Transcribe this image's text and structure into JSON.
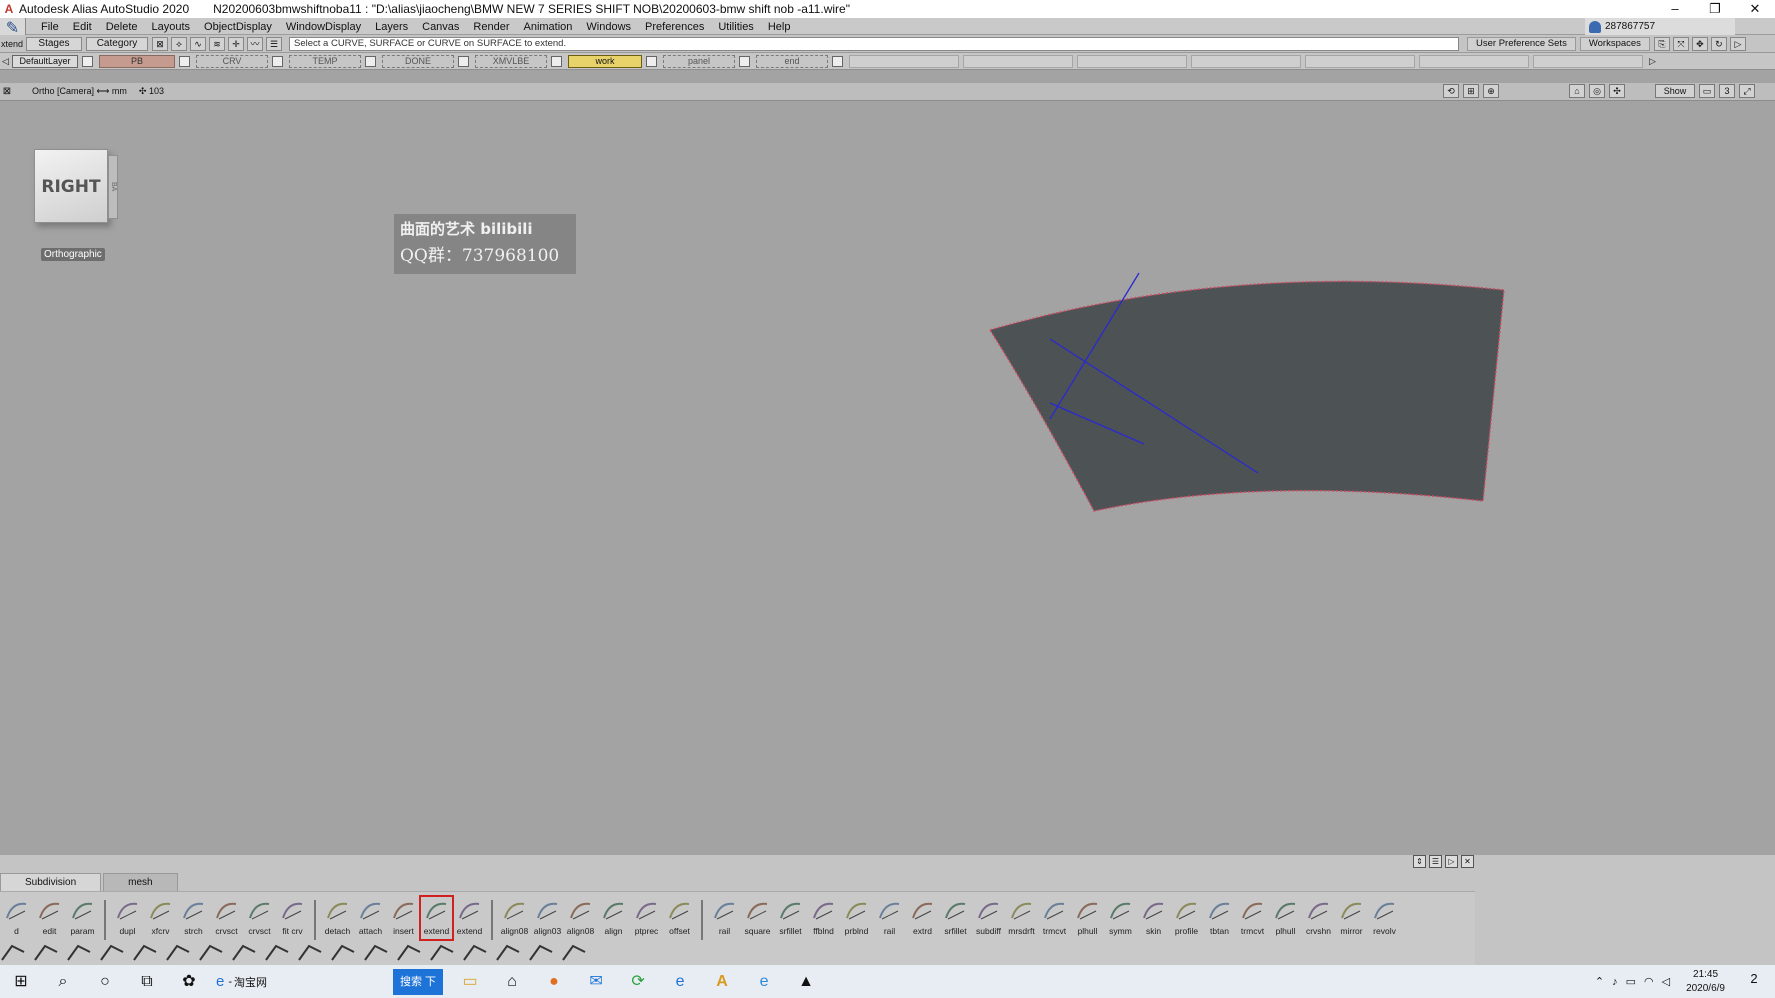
{
  "titlebar": {
    "app_name": "Autodesk Alias AutoStudio 2020",
    "doc_title": "N20200603bmwshiftnoba11 : \"D:\\alias\\jiaocheng\\BMW NEW 7 SERIES SHIFT NOB\\20200603-bmw shift nob -a11.wire\"",
    "minimize": "–",
    "restore": "❐",
    "close": "✕"
  },
  "menubar": {
    "items": [
      "File",
      "Edit",
      "Delete",
      "Layouts",
      "ObjectDisplay",
      "WindowDisplay",
      "Layers",
      "Canvas",
      "Render",
      "Animation",
      "Windows",
      "Preferences",
      "Utilities",
      "Help"
    ],
    "user_id": "287867757"
  },
  "promptbar": {
    "mode": "xtend",
    "stages": "Stages",
    "category": "Category",
    "prompt": "Select a CURVE, SURFACE or CURVE on SURFACE to extend.",
    "user_pref_sets": "User Preference Sets",
    "workspaces": "Workspaces"
  },
  "layerbar": {
    "default_layer": "DefaultLayer",
    "layers": [
      {
        "label": "PB",
        "style": "pb"
      },
      {
        "label": "CRV",
        "style": "dashed"
      },
      {
        "label": "TEMP",
        "style": "dashed"
      },
      {
        "label": "DONE",
        "style": "dashed"
      },
      {
        "label": "XMVLBE",
        "style": "dashed"
      },
      {
        "label": "work",
        "style": "active"
      },
      {
        "label": "panel",
        "style": "dashed"
      },
      {
        "label": "end",
        "style": "dashed"
      }
    ]
  },
  "viewheader": {
    "view_label": "Ortho [Camera]  ⟷ mm",
    "zoom_label": "✣ 103",
    "show_label": "Show"
  },
  "viewport": {
    "cube_face": "RIGHT",
    "cube_side": "BA",
    "ortho_label": "Orthographic",
    "watermark_line1": "曲面的艺术 bilibili",
    "watermark_line2": "QQ群：737968100",
    "surface_color": "#4d5255",
    "edge_color": "#d04860",
    "curve_color": "#2a2ad0"
  },
  "palette": {
    "tabs": [
      "Subdivision",
      "mesh"
    ],
    "tools": [
      "d",
      "edit",
      "param",
      "dupl",
      "xfcrv",
      "strch",
      "crvsct",
      "crvsct",
      "fit crv",
      "detach",
      "attach",
      "insert",
      "extend",
      "extend",
      "align08",
      "align03",
      "align08",
      "align",
      "ptprec",
      "offset",
      "rail",
      "square",
      "srfillet",
      "ffblnd",
      "prblnd",
      "rail",
      "extrd",
      "srfillet",
      "subdiff",
      "mrsdrft",
      "trmcvt",
      "plhull",
      "symm",
      "skin",
      "profile",
      "tbtan",
      "trmcvt",
      "plhull",
      "crvshn",
      "mirror",
      "revolv"
    ],
    "selected_index": 12
  },
  "taskbar": {
    "browser_label": "淘宝网",
    "search_label": "搜索  下",
    "time": "21:45",
    "date": "2020/6/9",
    "notify_count": "2"
  }
}
